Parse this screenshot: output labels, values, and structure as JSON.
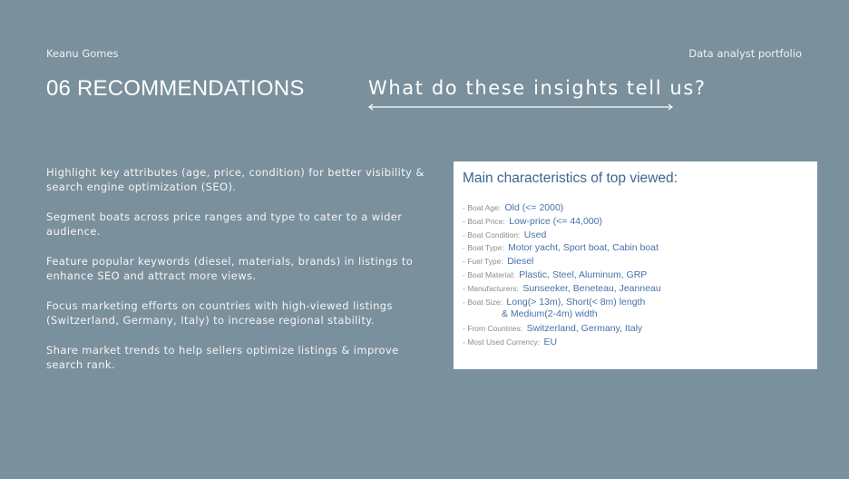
{
  "header": {
    "author": "Keanu Gomes",
    "portfolio": "Data analyst portfolio",
    "section_title": "06 RECOMMENDATIONS",
    "subtitle": "What do these insights tell us?"
  },
  "recommendations": [
    "Highlight key attributes (age, price, condition) for better visibility & search engine optimization (SEO).",
    "Segment boats across price ranges and type to cater to a wider audience.",
    "Feature popular keywords (diesel, materials, brands) in listings to enhance SEO and attract more views.",
    "Focus marketing efforts on countries with high-viewed listings (Switzerland, Germany, Italy) to increase regional stability.",
    "Share market trends to help sellers optimize listings & improve search rank."
  ],
  "card": {
    "title": "Main characteristics of top viewed:",
    "rows": [
      {
        "label": "- Boat Age:",
        "value": "Old  (<= 2000)"
      },
      {
        "label": "- Boat Price:",
        "value": "Low-price (<= 44,000)"
      },
      {
        "label": "- Boat Condition:",
        "value": "Used"
      },
      {
        "label": "- Boat Type:",
        "value": "Motor yacht, Sport boat, Cabin boat"
      },
      {
        "label": "- Fuel Type:",
        "value": "Diesel"
      },
      {
        "label": "- Boat Material:",
        "value": "Plastic, Steel, Aluminum, GRP"
      },
      {
        "label": "- Manufacturers:",
        "value": "Sunseeker, Beneteau, Jeanneau"
      },
      {
        "label": "- Boat Size:",
        "value": "Long(> 13m), Short(< 8m) length"
      }
    ],
    "size_continuation": "& Medium(2-4m) width",
    "rows_after": [
      {
        "label": "- From Countries:",
        "value": "Switzerland, Germany, Italy"
      },
      {
        "label": "- Most Used Currency:",
        "value": "EU"
      }
    ]
  },
  "colors": {
    "background": "#7a909c",
    "card_title": "#3d6593",
    "card_value": "#4672a8",
    "card_label": "#8c8c8c"
  }
}
